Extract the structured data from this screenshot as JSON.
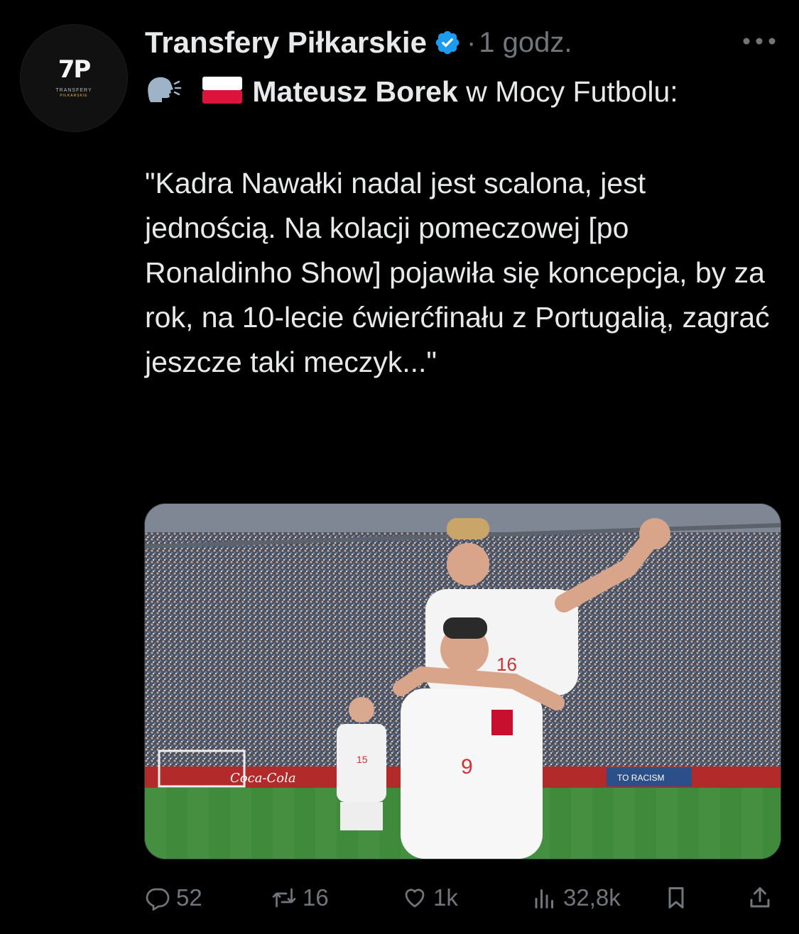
{
  "author": {
    "name": "Transfery Piłkarskie",
    "verified": true,
    "avatar_mark": "7P",
    "avatar_text_line1": "TRANSFERY",
    "avatar_text_line2": "PIŁKARSKIE"
  },
  "post": {
    "separator": "·",
    "time": "1 godz.",
    "emoji_speaking_head": "🗣",
    "emoji_flag": "🇵🇱",
    "mention_name": "Mateusz Borek",
    "intro_rest": " w Mocy Futbolu:",
    "quote": "\"Kadra Nawałki nadal jest scalona, jest jednością. Na kolacji pomeczowej [po Ronaldinho Show] pojawiła się koncepcja, by za rok, na 10-lecie ćwierćfinału z Portugalią, zagrać jeszcze taki meczyk...\""
  },
  "media": {
    "jersey_front_number": "9",
    "jersey_back_number": "16",
    "jersey_left_number": "15",
    "ad_text": "Coca-Cola",
    "banner_text": "TO RACISM"
  },
  "actions": {
    "replies": "52",
    "reposts": "16",
    "likes": "1k",
    "views": "32,8k"
  },
  "colors": {
    "background": "#000000",
    "text": "#e7e9ea",
    "muted": "#71767b",
    "verified_blue": "#1d9bf0"
  }
}
